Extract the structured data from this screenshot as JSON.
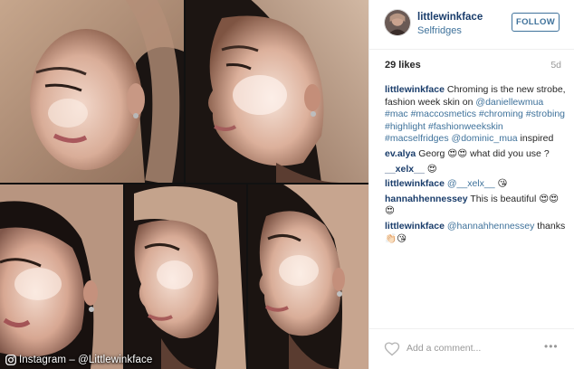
{
  "post": {
    "credit": "Instagram – @Littlewinkface",
    "photos": [
      {
        "label": "photo-1"
      },
      {
        "label": "photo-2"
      },
      {
        "label": "photo-3"
      },
      {
        "label": "photo-4"
      },
      {
        "label": "photo-5"
      }
    ]
  },
  "header": {
    "username": "littlewinkface",
    "location": "Selfridges",
    "follow_label": "FOLLOW"
  },
  "stats": {
    "likes": "29 likes",
    "age": "5d"
  },
  "comments": [
    {
      "user": "littlewinkface",
      "parts": [
        {
          "t": "txt",
          "v": "Chroming is the new strobe, fashion week skin on "
        },
        {
          "t": "tag",
          "v": "@daniellewmua"
        },
        {
          "t": "txt",
          "v": " "
        },
        {
          "t": "tag",
          "v": "#mac #maccosmetics #chroming #strobing #highlight #fashionweekskin #macselfridges @dominic_mua"
        },
        {
          "t": "txt",
          "v": " inspired"
        }
      ]
    },
    {
      "user": "ev.alya",
      "parts": [
        {
          "t": "txt",
          "v": "Georg 😍😍 what did you use ?"
        }
      ]
    },
    {
      "user": "__xelx__",
      "parts": [
        {
          "t": "txt",
          "v": "😍"
        }
      ]
    },
    {
      "user": "littlewinkface",
      "parts": [
        {
          "t": "tag",
          "v": "@__xelx__"
        },
        {
          "t": "txt",
          "v": " 😘"
        }
      ]
    },
    {
      "user": "hannahhennessey",
      "parts": [
        {
          "t": "txt",
          "v": "This is beautiful 😍😍😍"
        }
      ]
    },
    {
      "user": "littlewinkface",
      "parts": [
        {
          "t": "tag",
          "v": "@hannahhennessey"
        },
        {
          "t": "txt",
          "v": " thanks 👏🏻😘"
        }
      ]
    }
  ],
  "footer": {
    "add_comment_placeholder": "Add a comment...",
    "more_label": "•••"
  },
  "colors": {
    "username": "#1a3d6b",
    "link": "#3f729b",
    "muted": "#999999",
    "divider": "#efefef"
  },
  "icons": {
    "camera": "instagram-camera-icon",
    "heart": "heart-outline-icon",
    "more": "more-options-icon"
  }
}
